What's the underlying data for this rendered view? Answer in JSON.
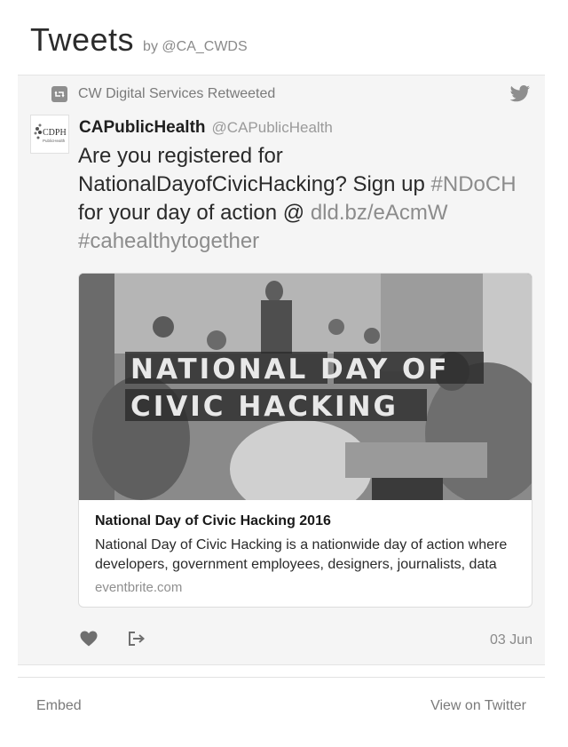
{
  "header": {
    "title": "Tweets",
    "by": "by @CA_CWDS"
  },
  "retweet": {
    "text": "CW Digital Services Retweeted"
  },
  "tweet": {
    "author_name": "CAPublicHealth",
    "author_handle": "@CAPublicHealth",
    "text_part1": "Are you registered for NationalDayofCivicHacking? Sign up ",
    "hashtag1": "#NDoCH",
    "text_part2": " for your day of action @ ",
    "link": "dld.bz/eAcmW",
    "hashtag2": "#cahealthytogether",
    "timestamp": "03 Jun"
  },
  "avatar": {
    "label": "CDPH",
    "sublabel": "PublicHealth"
  },
  "card": {
    "image_text_line1": "NATIONAL DAY OF",
    "image_text_line2": "CIVIC HACKING",
    "title": "National Day of Civic Hacking 2016",
    "description": "National Day of Civic Hacking is a nationwide day of action where developers, government employees, designers, journalists, data",
    "domain": "eventbrite.com"
  },
  "footer": {
    "embed": "Embed",
    "view_on_twitter": "View on Twitter"
  },
  "icons": {
    "retweet": "retweet-icon",
    "bird": "twitter-bird-icon",
    "like": "heart-icon",
    "share": "share-icon"
  },
  "colors": {
    "background": "#ffffff",
    "timeline_bg": "#f5f5f5",
    "muted_text": "#8a8a8a",
    "icon_gray": "#8e8e8e"
  }
}
